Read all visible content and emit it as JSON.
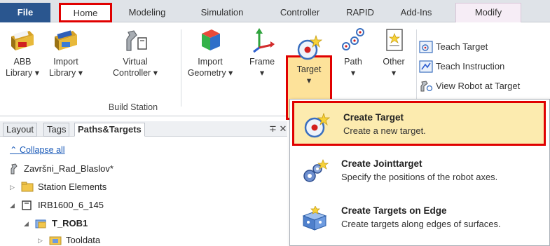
{
  "tabs": {
    "file": "File",
    "home": "Home",
    "modeling": "Modeling",
    "simulation": "Simulation",
    "controller": "Controller",
    "rapid": "RAPID",
    "addins": "Add-Ins",
    "modify": "Modify"
  },
  "ribbon": {
    "abb_library": [
      "ABB",
      "Library ▾"
    ],
    "import_library": [
      "Import",
      "Library ▾"
    ],
    "virtual_controller": [
      "Virtual",
      "Controller ▾"
    ],
    "import_geometry": [
      "Import",
      "Geometry ▾"
    ],
    "frame": [
      "Frame",
      "▾"
    ],
    "target": [
      "Target",
      "▾"
    ],
    "path": [
      "Path",
      "▾"
    ],
    "other": [
      "Other",
      "▾"
    ],
    "teach_target": "Teach Target",
    "teach_instruction": "Teach Instruction",
    "view_robot_at_target": "View Robot at Target",
    "group_label": "Build Station",
    "corner_glyph": "⇲"
  },
  "panel": {
    "tabs": [
      "Layout",
      "Tags",
      "Paths&Targets"
    ],
    "pin_glyph": "∓ ✕",
    "collapse_all": "Collapse all",
    "tree": {
      "station": "Završni_Rad_Blaslov*",
      "station_elements": "Station Elements",
      "robot": "IRB1600_6_145",
      "task": "T_ROB1",
      "tooldata": "Tooldata"
    }
  },
  "dropdown": [
    {
      "title": "Create Target",
      "desc": "Create a new target."
    },
    {
      "title": "Create Jointtarget",
      "desc": "Specify the positions of the robot axes."
    },
    {
      "title": "Create Targets on Edge",
      "desc": "Create targets along edges of surfaces."
    }
  ],
  "colors": {
    "file_tab": "#2a568f",
    "highlight_border": "#e00000",
    "hover_fill": "#fcebaf"
  }
}
